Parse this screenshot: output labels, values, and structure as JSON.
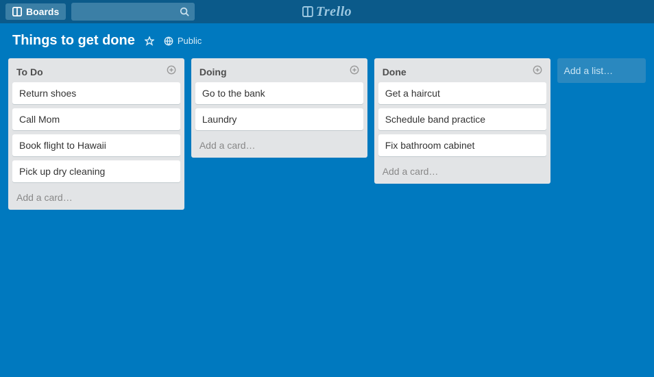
{
  "topbar": {
    "boards_label": "Boards",
    "logo_text": "Trello"
  },
  "board": {
    "title": "Things to get done",
    "visibility_label": "Public"
  },
  "lists": [
    {
      "title": "To Do",
      "cards": [
        "Return shoes",
        "Call Mom",
        "Book flight to Hawaii",
        "Pick up dry cleaning"
      ],
      "add_card_label": "Add a card…"
    },
    {
      "title": "Doing",
      "cards": [
        "Go to the bank",
        "Laundry"
      ],
      "add_card_label": "Add a card…"
    },
    {
      "title": "Done",
      "cards": [
        "Get a haircut",
        "Schedule band practice",
        "Fix bathroom cabinet"
      ],
      "add_card_label": "Add a card…"
    }
  ],
  "add_list_label": "Add a list…"
}
